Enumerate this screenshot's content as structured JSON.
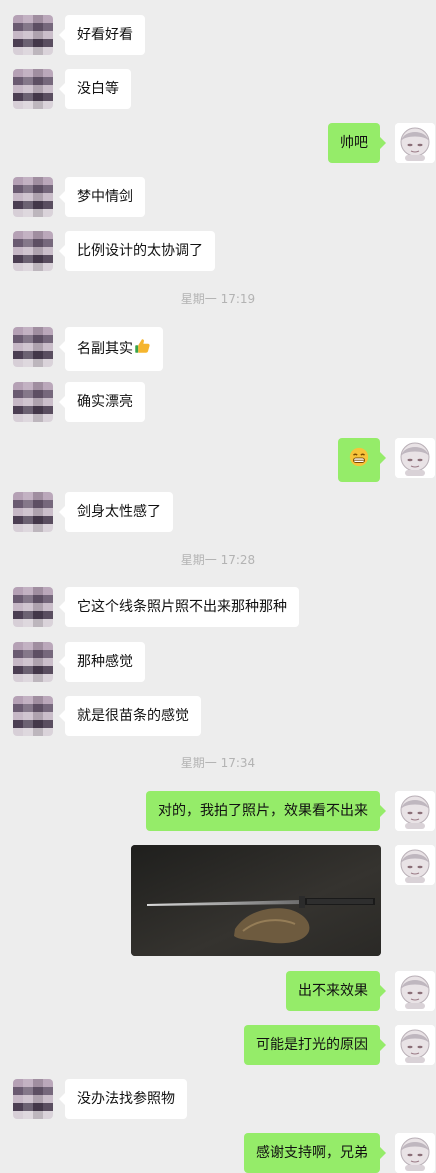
{
  "messages": [
    {
      "side": "left",
      "text": "好看好看"
    },
    {
      "side": "left",
      "text": "没白等"
    },
    {
      "side": "right",
      "text": "帅吧"
    },
    {
      "side": "left",
      "text": "梦中情剑"
    },
    {
      "side": "left",
      "text": "比例设计的太协调了"
    },
    {
      "timestamp": "星期一 17:19"
    },
    {
      "side": "left",
      "text": "名副其实",
      "emoji": "thumbs-up-icon"
    },
    {
      "side": "left",
      "text": "确实漂亮"
    },
    {
      "side": "right",
      "emoji": "grin-face-icon"
    },
    {
      "side": "left",
      "text": "剑身太性感了"
    },
    {
      "timestamp": "星期一 17:28"
    },
    {
      "side": "left",
      "text": "它这个线条照片照不出来那种那种"
    },
    {
      "side": "left",
      "text": "那种感觉"
    },
    {
      "side": "left",
      "text": "就是很苗条的感觉"
    },
    {
      "timestamp": "星期一 17:34"
    },
    {
      "side": "right",
      "text": "对的，我拍了照片，效果看不出来"
    },
    {
      "side": "right",
      "image": "sword-photo"
    },
    {
      "side": "right",
      "text": "出不来效果"
    },
    {
      "side": "right",
      "text": "可能是打光的原因"
    },
    {
      "side": "left",
      "text": "没办法找参照物"
    },
    {
      "side": "right",
      "text": "感谢支持啊，兄弟"
    }
  ],
  "colors": {
    "background": "#ededed",
    "left_bubble": "#ffffff",
    "right_bubble": "#95ec69",
    "timestamp": "#b3b3b3"
  },
  "icons": {
    "left_avatar": "pixelated-avatar",
    "right_avatar": "cartoon-face-avatar"
  }
}
